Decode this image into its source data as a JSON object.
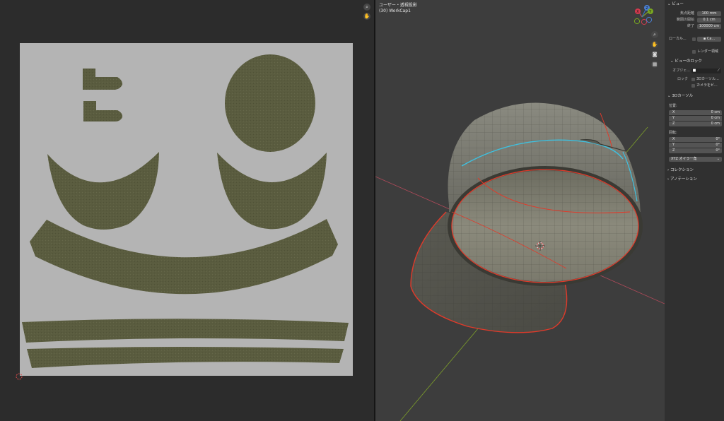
{
  "viewport": {
    "title": "ユーザー・透視投影",
    "subtitle": "(30) WorkCap1",
    "gizmo": {
      "x": "X",
      "y": "Y",
      "z": "Z"
    },
    "nav_icons": [
      "zoom-icon",
      "hand-icon",
      "camera-icon",
      "grid-icon"
    ]
  },
  "uv_editor": {
    "nav_icons": [
      "zoom-icon",
      "hand-icon"
    ]
  },
  "sidebar": {
    "view_section": {
      "title": "ビュー",
      "focal_label": "焦点距離",
      "focal_value": "100 mm",
      "clip_start_label": "範囲の開始",
      "clip_start_value": "0.1 cm",
      "clip_end_label": "終了",
      "clip_end_value": "100000 cm",
      "local_camera_label": "ローカル...",
      "local_camera_value": "Ca...",
      "render_region_label": "レンダー領域"
    },
    "lock_section": {
      "title": "ビューのロック",
      "object_label": "オブジェ...",
      "lock_label": "ロック",
      "lock_3d_cursor": "3Dカーソル...",
      "camera_to_view": "カメラをビ..."
    },
    "cursor_section": {
      "title": "3Dカーソル",
      "location_label": "位置:",
      "location": [
        {
          "axis": "X",
          "value": "0 cm"
        },
        {
          "axis": "Y",
          "value": "0 cm"
        },
        {
          "axis": "Z",
          "value": "0 cm"
        }
      ],
      "rotation_label": "回転:",
      "rotation": [
        {
          "axis": "X",
          "value": "0°"
        },
        {
          "axis": "Y",
          "value": "0°"
        },
        {
          "axis": "Z",
          "value": "0°"
        }
      ],
      "rotation_mode": "XYZ オイラー角"
    },
    "collection_section": {
      "title": "コレクション"
    },
    "annotation_section": {
      "title": "アノテーション"
    }
  },
  "colors": {
    "uv_background": "#b3b3b3",
    "uv_island": "#5a5c3f",
    "seam": "#e03a2a",
    "seam_selected": "#3ec1e0",
    "x_axis": "#b24a5a",
    "y_axis": "#7ea02a"
  }
}
